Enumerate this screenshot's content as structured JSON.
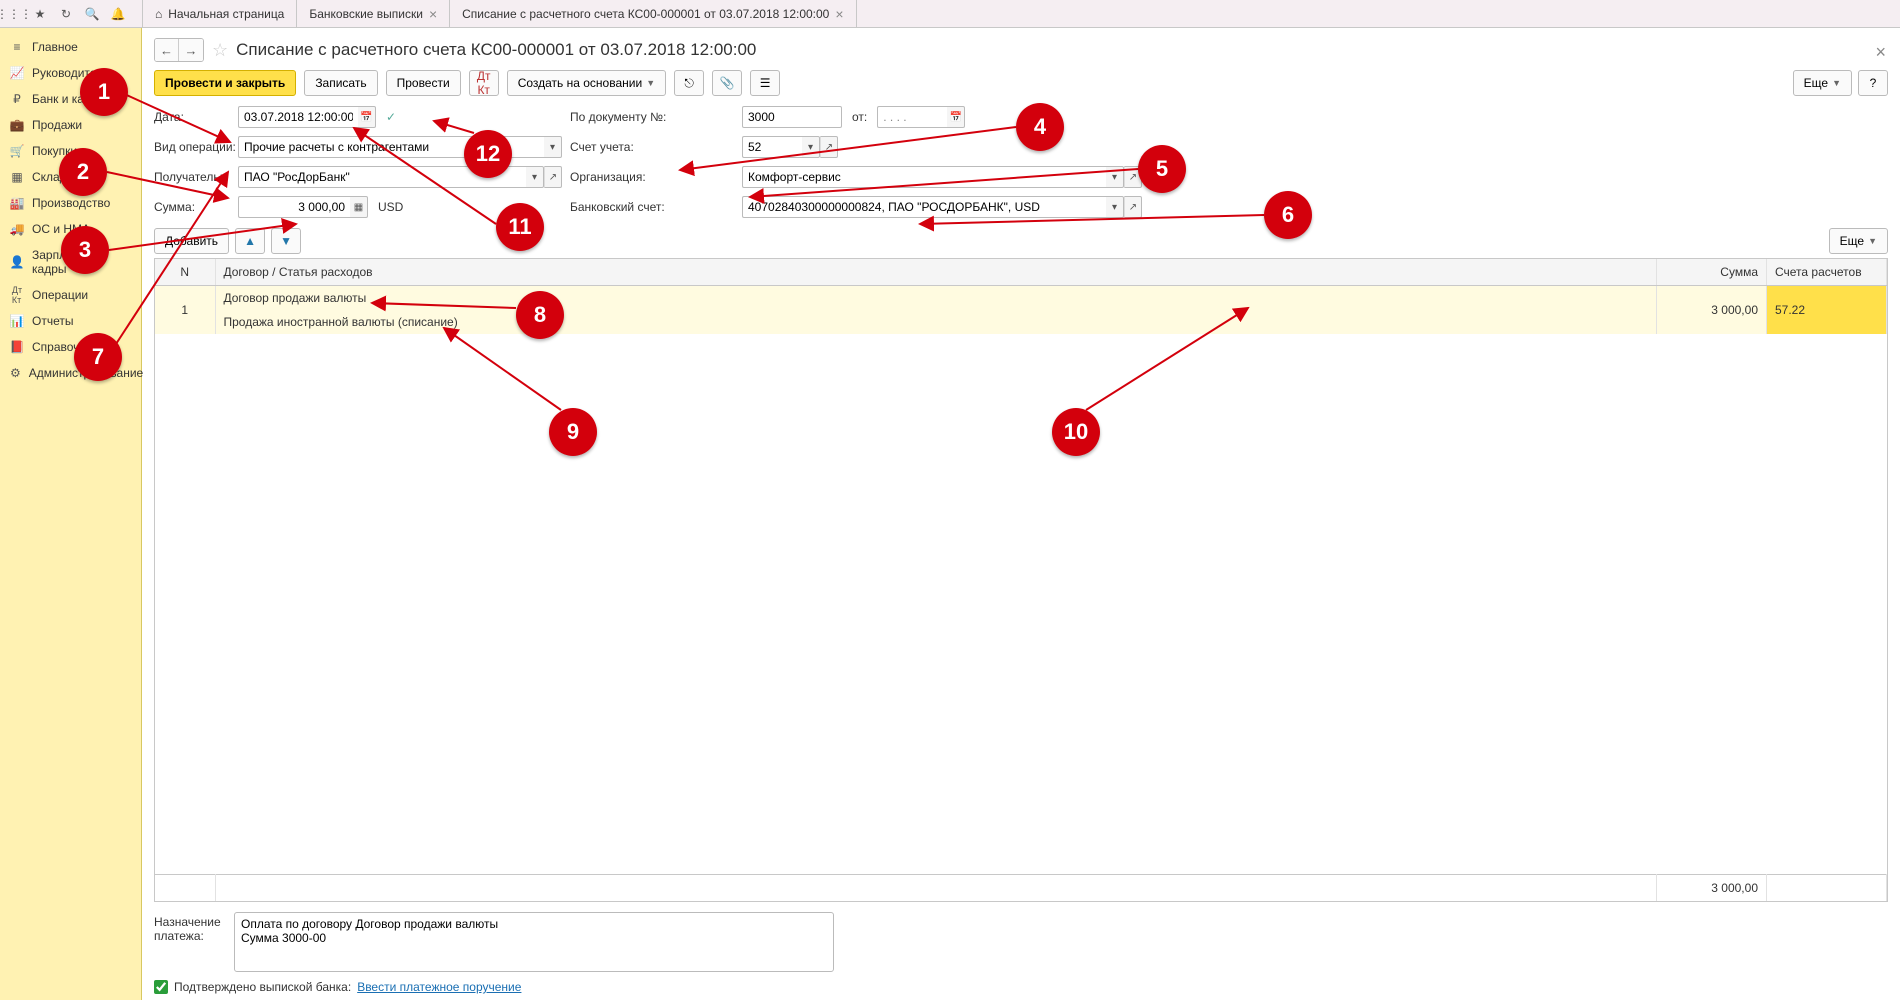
{
  "tabs": {
    "home": "Начальная страница",
    "t1": "Банковские выписки",
    "t2": "Списание с расчетного счета КС00-000001 от 03.07.2018 12:00:00"
  },
  "sidebar": [
    {
      "label": "Главное"
    },
    {
      "label": "Руководителю"
    },
    {
      "label": "Банк и касса"
    },
    {
      "label": "Продажи"
    },
    {
      "label": "Покупки"
    },
    {
      "label": "Склад"
    },
    {
      "label": "Производство"
    },
    {
      "label": "ОС и НМА"
    },
    {
      "label": "Зарплата и кадры"
    },
    {
      "label": "Операции"
    },
    {
      "label": "Отчеты"
    },
    {
      "label": "Справочники"
    },
    {
      "label": "Администрирование"
    }
  ],
  "title": "Списание с расчетного счета КС00-000001 от 03.07.2018 12:00:00",
  "toolbar": {
    "post_close": "Провести и закрыть",
    "save": "Записать",
    "post": "Провести",
    "create_on_basis": "Создать на основании",
    "more": "Еще"
  },
  "form": {
    "date_label": "Дата:",
    "date": "03.07.2018 12:00:00",
    "op_label": "Вид операции:",
    "op": "Прочие расчеты с контрагентами",
    "payee_label": "Получатель:",
    "payee": "ПАО \"РосДорБанк\"",
    "sum_label": "Сумма:",
    "sum": "3 000,00",
    "currency": "USD",
    "doc_no_label": "По документу №:",
    "doc_no": "3000",
    "from_label": "от:",
    "from": ". . . .",
    "acct_label": "Счет учета:",
    "acct": "52",
    "org_label": "Организация:",
    "org": "Комфорт-сервис",
    "bank_acct_label": "Банковский счет:",
    "bank_acct": "40702840300000000824, ПАО \"РОСДОРБАНК\", USD"
  },
  "table": {
    "add": "Добавить",
    "more": "Еще",
    "cols": {
      "n": "N",
      "contract": "Договор / Статья расходов",
      "sum": "Сумма",
      "acc": "Счета расчетов"
    },
    "row": {
      "n": "1",
      "contract": "Договор продажи валюты",
      "expense": "Продажа иностранной валюты (списание)",
      "sum": "3 000,00",
      "acc": "57.22"
    },
    "total": "3 000,00"
  },
  "footer": {
    "purpose_label": "Назначение платежа:",
    "purpose": "Оплата по договору Договор продажи валюты\nСумма 3000-00",
    "confirm": "Подтверждено выпиской банка:",
    "enter_link": "Ввести платежное поручение"
  },
  "callouts": [
    "1",
    "2",
    "3",
    "4",
    "5",
    "6",
    "7",
    "8",
    "9",
    "10",
    "11",
    "12"
  ]
}
